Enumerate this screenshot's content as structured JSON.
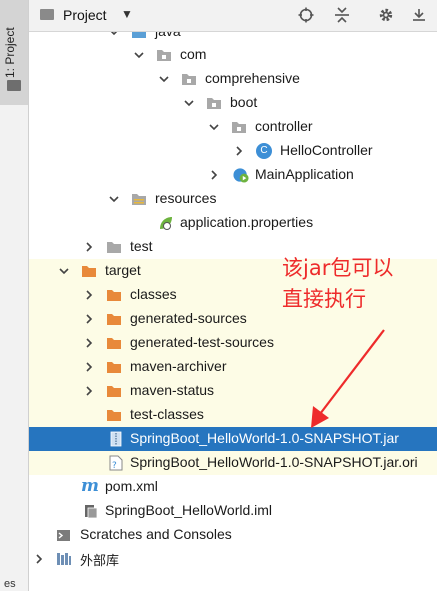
{
  "sidebar": {
    "tab_label": "1: Project",
    "bottom_label": "es"
  },
  "header": {
    "title": "Project"
  },
  "tree": [
    {
      "label": "java"
    },
    {
      "label": "com"
    },
    {
      "label": "comprehensive"
    },
    {
      "label": "boot"
    },
    {
      "label": "controller"
    },
    {
      "label": "HelloController",
      "badge": "C"
    },
    {
      "label": "MainApplication"
    },
    {
      "label": "resources"
    },
    {
      "label": "application.properties"
    },
    {
      "label": "test"
    },
    {
      "label": "target"
    },
    {
      "label": "classes"
    },
    {
      "label": "generated-sources"
    },
    {
      "label": "generated-test-sources"
    },
    {
      "label": "maven-archiver"
    },
    {
      "label": "maven-status"
    },
    {
      "label": "test-classes"
    },
    {
      "label": "SpringBoot_HelloWorld-1.0-SNAPSHOT.jar"
    },
    {
      "label": "SpringBoot_HelloWorld-1.0-SNAPSHOT.jar.ori"
    },
    {
      "label": "pom.xml",
      "badge": "m"
    },
    {
      "label": "SpringBoot_HelloWorld.iml"
    },
    {
      "label": "Scratches and Consoles"
    },
    {
      "label": "外部库"
    }
  ],
  "annotation": {
    "line1": "该jar包可以",
    "line2": "直接执行"
  },
  "colors": {
    "selection": "#2675bf",
    "highlight": "#fdfce6",
    "folder": "#e8893a",
    "annotation": "#ee2b2b",
    "spring": "#6db33f",
    "class": "#3d8fd6"
  }
}
